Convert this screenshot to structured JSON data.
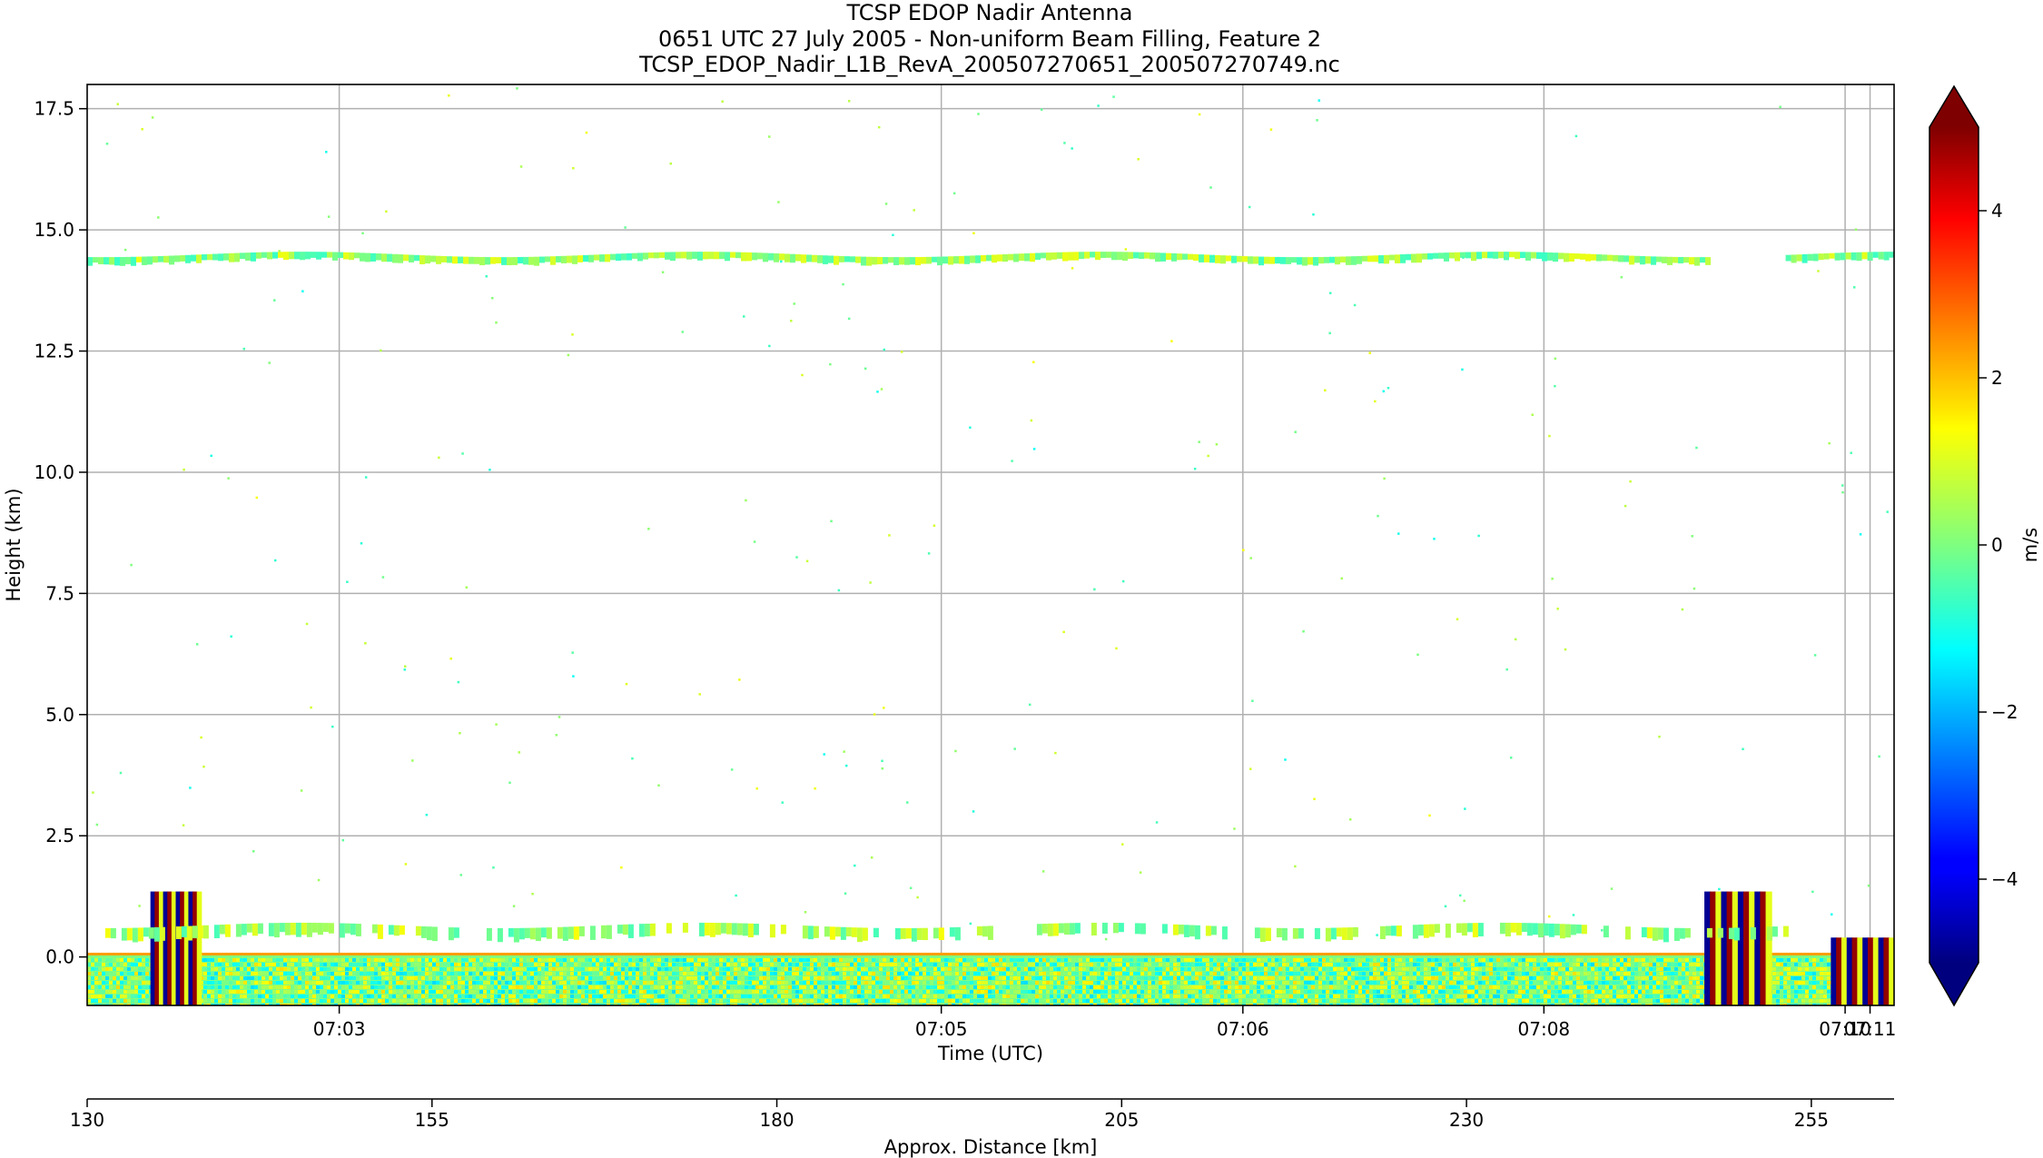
{
  "chart_data": {
    "type": "heatmap",
    "title_lines": [
      "TCSP EDOP Nadir Antenna",
      "0651 UTC 27 July 2005 - Non-uniform Beam Filling, Feature 2",
      "TCSP_EDOP_Nadir_L1B_RevA_200507270651_200507270749.nc"
    ],
    "xlabel": "Time (UTC)",
    "ylabel": "Height (km)",
    "x_tick_labels": [
      "07:03",
      "07:05",
      "07:06",
      "07:08",
      "07:10",
      "07:11"
    ],
    "y_ticks": [
      0.0,
      2.5,
      5.0,
      7.5,
      10.0,
      12.5,
      15.0,
      17.5
    ],
    "y_tick_labels": [
      "0.0",
      "2.5",
      "5.0",
      "7.5",
      "10.0",
      "12.5",
      "15.0",
      "17.5"
    ],
    "ylim": [
      -1.0,
      18.0
    ],
    "grid": true,
    "secondary_axis": {
      "label": "Approx. Distance [km]",
      "xlim": [
        130,
        261
      ],
      "ticks": [
        130,
        155,
        180,
        205,
        230,
        255
      ],
      "tick_labels": [
        "130",
        "155",
        "180",
        "205",
        "230",
        "255"
      ]
    },
    "colorbar": {
      "label": "m/s",
      "colormap": "jet",
      "vmin": -5,
      "vmax": 5,
      "extend": "both",
      "ticks": [
        -4,
        -2,
        0,
        2,
        4
      ],
      "tick_labels": [
        "−4",
        "−2",
        "0",
        "2",
        "4"
      ]
    },
    "features": [
      {
        "kind": "layer",
        "height_km": 14.4,
        "velocity_ms": 0.2,
        "x_frac": [
          0.0,
          0.898
        ]
      },
      {
        "kind": "layer",
        "height_km": 14.4,
        "velocity_ms": 0.2,
        "x_frac": [
          0.94,
          1.0
        ]
      },
      {
        "kind": "layer",
        "height_km": 0.5,
        "velocity_ms": 0.3,
        "x_frac": [
          0.01,
          0.94
        ]
      },
      {
        "kind": "surface",
        "height_range_km": [
          -1.0,
          0.05
        ],
        "velocity_ms": 0.0
      }
    ]
  }
}
